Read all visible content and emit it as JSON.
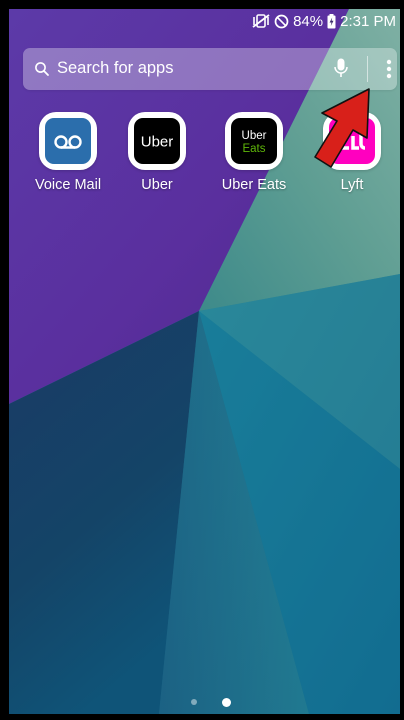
{
  "status_bar": {
    "battery_text": "84%",
    "time": "2:31 PM",
    "icons": [
      "vibrate-mute-icon",
      "do-not-disturb-icon",
      "battery-charging-icon"
    ]
  },
  "search": {
    "placeholder": "Search for apps",
    "icons": [
      "search-icon",
      "microphone-icon",
      "more-options-icon"
    ]
  },
  "apps": [
    {
      "label": "Voice Mail",
      "icon": "voicemail-icon",
      "color": "#2b6eac"
    },
    {
      "label": "Uber",
      "icon": "uber-logo",
      "inner_text": "Uber",
      "color": "#000000"
    },
    {
      "label": "Uber Eats",
      "icon": "uber-eats-logo",
      "inner_text_top": "Uber",
      "inner_text_bottom": "Eats",
      "color": "#000000",
      "accent": "#5fb709"
    },
    {
      "label": "Lyft",
      "icon": "lyft-logo",
      "color": "#ff00bf"
    }
  ],
  "page_indicator": {
    "pages": 2,
    "current": 2
  },
  "annotation": {
    "type": "arrow",
    "color": "#d8201a",
    "points_to": "more-options-icon"
  },
  "colors": {
    "purple": "#5b32a1",
    "teal_green": "#63a195",
    "dark_navy": "#153d5e",
    "teal_blue": "#1d7391"
  }
}
